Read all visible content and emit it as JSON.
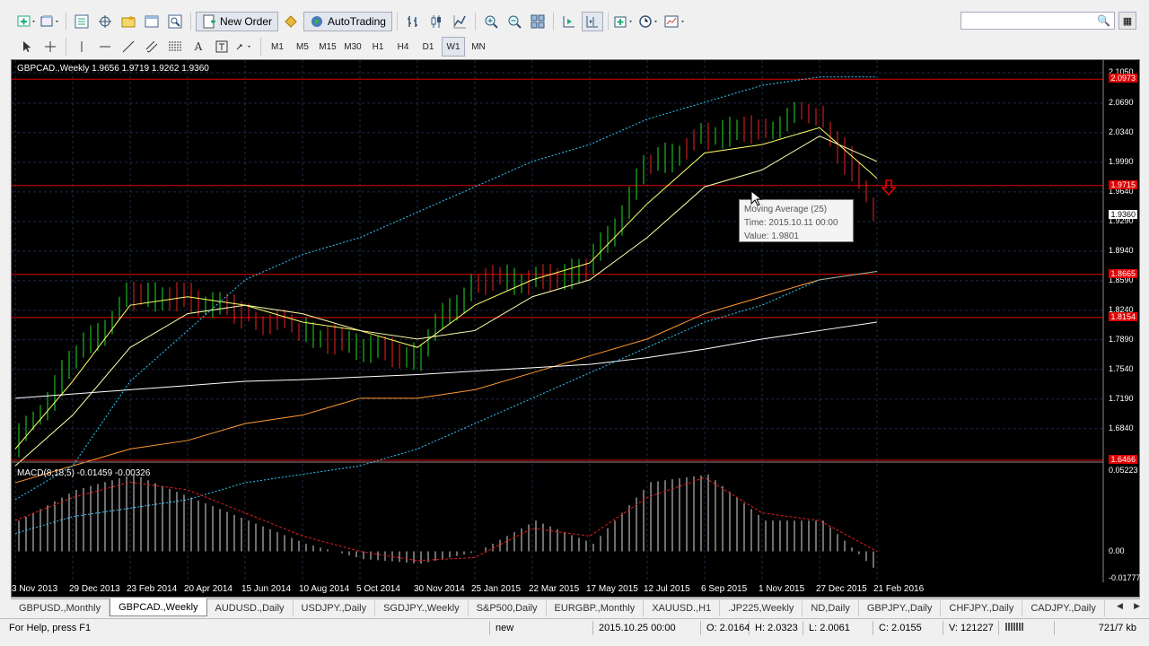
{
  "toolbar": {
    "new_order_label": "New Order",
    "autotrading_label": "AutoTrading",
    "timeframes": [
      "M1",
      "M5",
      "M15",
      "M30",
      "H1",
      "H4",
      "D1",
      "W1",
      "MN"
    ],
    "active_timeframe": "W1"
  },
  "search": {
    "placeholder": ""
  },
  "chart": {
    "title": "GBPCAD.,Weekly  1.9656 1.9719 1.9262 1.9360",
    "macd_title": "MACD(8,18,5) -0.01459 -0.00326",
    "price_axis": [
      "2.1050",
      "2.0690",
      "2.0340",
      "1.9990",
      "1.9640",
      "1.9290",
      "1.8940",
      "1.8590",
      "1.8240",
      "1.7890",
      "1.7540",
      "1.7190",
      "1.6840"
    ],
    "price_tags": [
      {
        "value": "2.0973",
        "color": "#e00000"
      },
      {
        "value": "1.9715",
        "color": "#e00000"
      },
      {
        "value": "1.9360",
        "color": "#ffffff"
      },
      {
        "value": "1.8665",
        "color": "#e00000"
      },
      {
        "value": "1.8154",
        "color": "#e00000"
      },
      {
        "value": "1.6466",
        "color": "#e00000"
      }
    ],
    "macd_axis": [
      "0.05223",
      "0.00",
      "-0.01777"
    ],
    "time_axis": [
      "3 Nov 2013",
      "29 Dec 2013",
      "23 Feb 2014",
      "20 Apr 2014",
      "15 Jun 2014",
      "10 Aug 2014",
      "5 Oct 2014",
      "30 Nov 2014",
      "25 Jan 2015",
      "22 Mar 2015",
      "17 May 2015",
      "12 Jul 2015",
      "6 Sep 2015",
      "1 Nov 2015",
      "27 Dec 2015",
      "21 Feb 2016"
    ],
    "tooltip": {
      "name": "Moving Average (25)",
      "time": "Time: 2015.10.11 00:00",
      "value": "Value: 1.9801"
    }
  },
  "chart_data": {
    "type": "line",
    "title": "GBPCAD.,Weekly",
    "ylim": [
      1.6466,
      2.105
    ],
    "ohlc_last": {
      "open": 1.9656,
      "high": 1.9719,
      "low": 1.9262,
      "close": 1.936
    },
    "horizontal_levels": [
      2.0973,
      1.9715,
      1.8665,
      1.8154,
      1.6466
    ],
    "grid": true,
    "x": [
      "3 Nov 2013",
      "29 Dec 2013",
      "23 Feb 2014",
      "20 Apr 2014",
      "15 Jun 2014",
      "10 Aug 2014",
      "5 Oct 2014",
      "30 Nov 2014",
      "25 Jan 2015",
      "22 Mar 2015",
      "17 May 2015",
      "12 Jul 2015",
      "6 Sep 2015",
      "1 Nov 2015",
      "27 Dec 2015",
      "21 Feb 2016"
    ],
    "series": [
      {
        "values": [
          1.66,
          1.76,
          1.84,
          1.84,
          1.82,
          1.8,
          1.78,
          1.77,
          1.86,
          1.86,
          1.87,
          1.99,
          2.03,
          2.04,
          2.06,
          1.94
        ],
        "color": "#22dd22"
      },
      {
        "values": [
          1.66,
          1.74,
          1.83,
          1.84,
          1.83,
          1.81,
          1.8,
          1.78,
          1.83,
          1.86,
          1.88,
          1.95,
          2.01,
          2.02,
          2.04,
          1.98
        ],
        "color": "#ffff66"
      },
      {
        "values": [
          1.64,
          1.7,
          1.78,
          1.82,
          1.83,
          1.82,
          1.8,
          1.79,
          1.8,
          1.84,
          1.86,
          1.91,
          1.97,
          1.99,
          2.03,
          2.0
        ],
        "color": "#ffffaa"
      },
      {
        "values": [
          1.62,
          1.64,
          1.66,
          1.67,
          1.69,
          1.7,
          1.72,
          1.72,
          1.73,
          1.75,
          1.77,
          1.79,
          1.82,
          1.84,
          1.86,
          1.87
        ],
        "color": "#ff9933"
      },
      {
        "values": [
          1.72,
          1.725,
          1.73,
          1.735,
          1.74,
          1.742,
          1.745,
          1.748,
          1.752,
          1.756,
          1.76,
          1.768,
          1.778,
          1.79,
          1.8,
          1.81
        ],
        "color": "#ffffff"
      },
      {
        "values": [
          1.6,
          1.64,
          1.74,
          1.8,
          1.86,
          1.89,
          1.91,
          1.94,
          1.97,
          2.0,
          2.02,
          2.05,
          2.07,
          2.09,
          2.1,
          2.1
        ],
        "color": "#33ccff"
      },
      {
        "values": [
          1.56,
          1.58,
          1.59,
          1.6,
          1.62,
          1.63,
          1.64,
          1.66,
          1.69,
          1.72,
          1.75,
          1.78,
          1.81,
          1.83,
          1.86,
          1.87
        ],
        "color": "#33ccff"
      }
    ],
    "macd": {
      "ylim": [
        -0.01777,
        0.05223
      ],
      "histogram": [
        0.02,
        0.04,
        0.05,
        0.035,
        0.02,
        0.005,
        -0.005,
        -0.008,
        0.0,
        0.02,
        0.005,
        0.045,
        0.05,
        0.02,
        0.02,
        -0.015
      ],
      "signal": [
        0.02,
        0.035,
        0.045,
        0.04,
        0.025,
        0.01,
        0.0,
        -0.006,
        -0.004,
        0.015,
        0.01,
        0.035,
        0.048,
        0.025,
        0.02,
        0.0
      ]
    }
  },
  "tabs": [
    {
      "label": "GBPUSD.,Monthly",
      "active": false
    },
    {
      "label": "GBPCAD.,Weekly",
      "active": true
    },
    {
      "label": "AUDUSD.,Daily",
      "active": false
    },
    {
      "label": "USDJPY.,Daily",
      "active": false
    },
    {
      "label": "SGDJPY.,Weekly",
      "active": false
    },
    {
      "label": "S&P500,Daily",
      "active": false
    },
    {
      "label": "EURGBP.,Monthly",
      "active": false
    },
    {
      "label": "XAUUSD.,H1",
      "active": false
    },
    {
      "label": ".JP225,Weekly",
      "active": false
    },
    {
      "label": "ND,Daily",
      "active": false
    },
    {
      "label": "GBPJPY.,Daily",
      "active": false
    },
    {
      "label": "CHFJPY.,Daily",
      "active": false
    },
    {
      "label": "CADJPY.,Daily",
      "active": false
    }
  ],
  "status": {
    "help": "For Help, press F1",
    "profile": "new",
    "datetime": "2015.10.25 00:00",
    "open": "O: 2.0164",
    "high": "H: 2.0323",
    "low": "L: 2.0061",
    "close": "C: 2.0155",
    "volume": "V: 121227",
    "traffic": "721/7 kb"
  },
  "icons": {
    "new_order": "new-order-icon",
    "autotrading": "autotrading-icon",
    "search": "search-icon"
  }
}
